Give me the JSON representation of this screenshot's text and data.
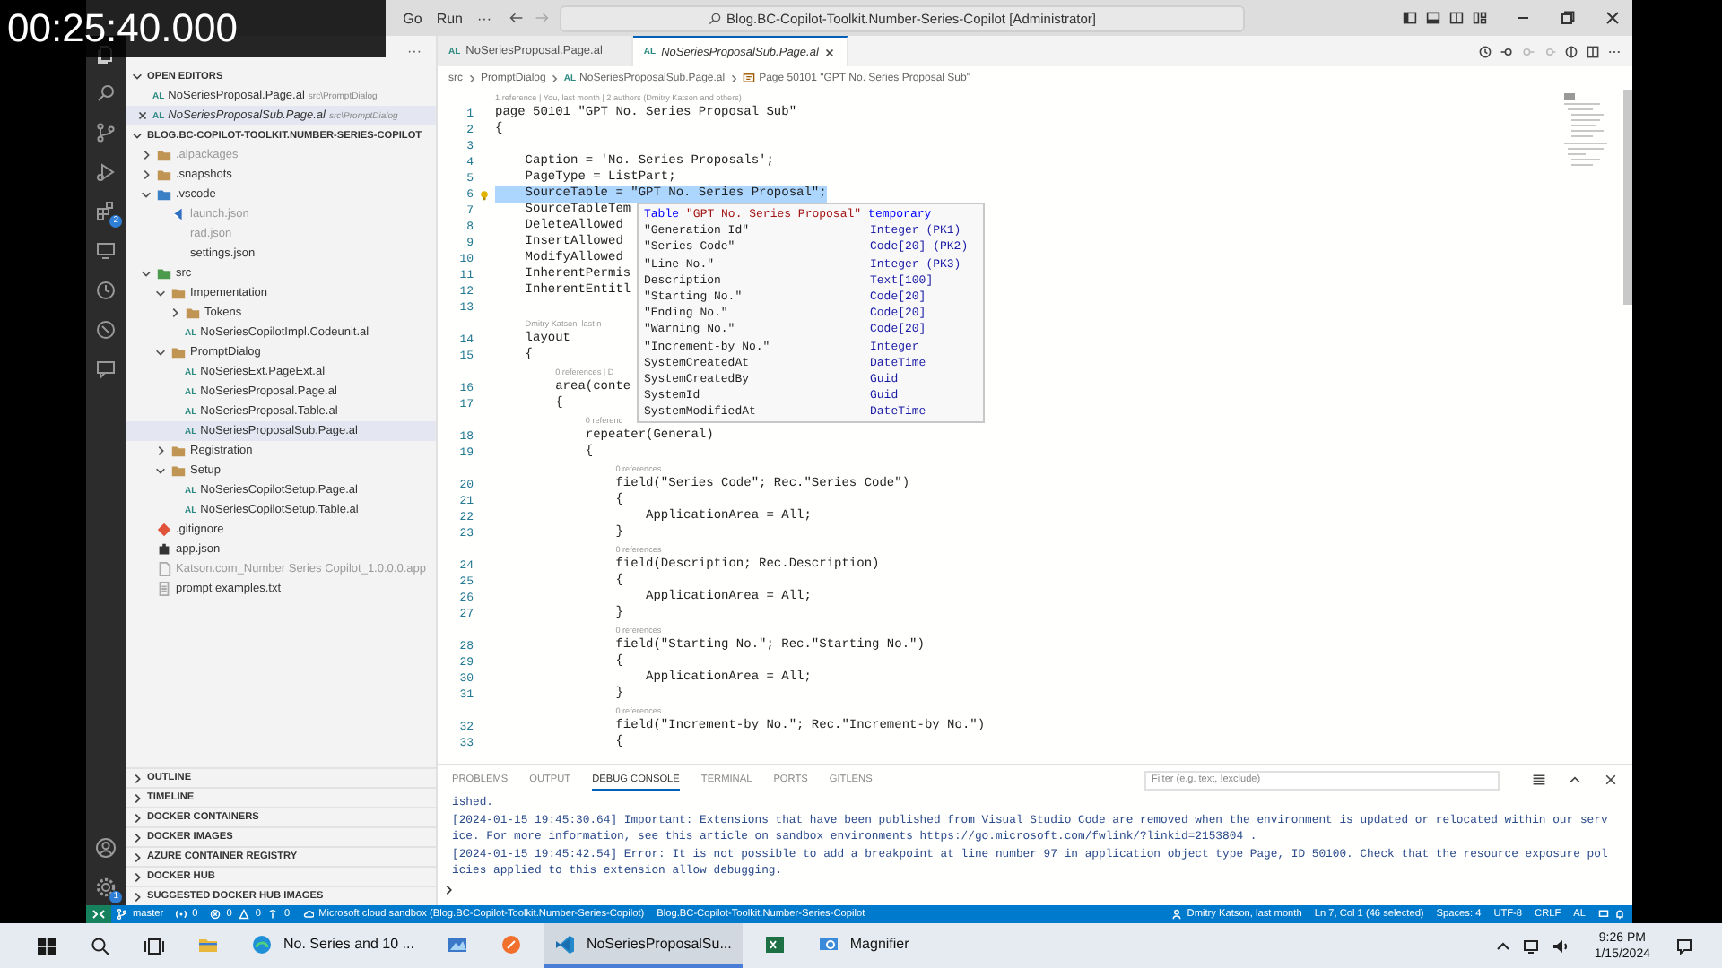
{
  "timestamp": "00:25:40.000",
  "menu": [
    "Go",
    "Run",
    "···"
  ],
  "command_center": "Blog.BC-Copilot-Toolkit.Number-Series-Copilot [Administrator]",
  "activity_bar": {
    "extensions_badge": "2",
    "settings_badge": "1"
  },
  "sidebar": {
    "more": "···",
    "open_editors": {
      "title": "OPEN EDITORS",
      "expanded": true,
      "items": [
        {
          "name": "NoSeriesProposal.Page.al",
          "label": "AL",
          "path": "src\\PromptDialog",
          "selected": false
        },
        {
          "name": "NoSeriesProposalSub.Page.al",
          "label": "AL",
          "path": "src\\PromptDialog",
          "selected": true
        }
      ]
    },
    "workspace": {
      "title": "BLOG.BC-COPILOT-TOOLKIT.NUMBER-SERIES-COPILOT",
      "expanded": true,
      "tree": [
        {
          "name": ".alpackages",
          "kind": "folder",
          "expanded": false,
          "selected": false,
          "dimmed": true
        },
        {
          "name": ".snapshots",
          "kind": "folder",
          "expanded": false,
          "selected": false,
          "dimmed": false
        },
        {
          "name": ".vscode",
          "kind": "vscode-folder",
          "expanded": true,
          "selected": false,
          "dimmed": false,
          "children": [
            {
              "name": "launch.json",
              "kind": "launch",
              "selected": false,
              "dimmed": true
            },
            {
              "name": "rad.json",
              "kind": "plain",
              "selected": false,
              "dimmed": true
            },
            {
              "name": "settings.json",
              "kind": "plain",
              "selected": false,
              "dimmed": false
            }
          ]
        },
        {
          "name": "src",
          "kind": "src-folder",
          "expanded": true,
          "selected": false,
          "dimmed": false,
          "children": [
            {
              "name": "Impementation",
              "kind": "folder",
              "expanded": true,
              "selected": false,
              "dimmed": false,
              "children": [
                {
                  "name": "Tokens",
                  "kind": "folder",
                  "expanded": false,
                  "selected": false,
                  "dimmed": false
                },
                {
                  "name": "NoSeriesCopilotImpl.Codeunit.al",
                  "kind": "al",
                  "label": "AL",
                  "selected": false,
                  "dimmed": false
                }
              ]
            },
            {
              "name": "PromptDialog",
              "kind": "folder",
              "expanded": true,
              "selected": false,
              "dimmed": false,
              "children": [
                {
                  "name": "NoSeriesExt.PageExt.al",
                  "kind": "al",
                  "label": "AL",
                  "selected": false,
                  "dimmed": false
                },
                {
                  "name": "NoSeriesProposal.Page.al",
                  "kind": "al",
                  "label": "AL",
                  "selected": false,
                  "dimmed": false
                },
                {
                  "name": "NoSeriesProposal.Table.al",
                  "kind": "al",
                  "label": "AL",
                  "selected": false,
                  "dimmed": false
                },
                {
                  "name": "NoSeriesProposalSub.Page.al",
                  "kind": "al",
                  "label": "AL",
                  "selected": true,
                  "dimmed": false
                }
              ]
            },
            {
              "name": "Registration",
              "kind": "folder",
              "expanded": false,
              "selected": false,
              "dimmed": false
            },
            {
              "name": "Setup",
              "kind": "folder",
              "expanded": true,
              "selected": false,
              "dimmed": false,
              "children": [
                {
                  "name": "NoSeriesCopilotSetup.Page.al",
                  "kind": "al",
                  "label": "AL",
                  "selected": false,
                  "dimmed": false
                },
                {
                  "name": "NoSeriesCopilotSetup.Table.al",
                  "kind": "al",
                  "label": "AL",
                  "selected": false,
                  "dimmed": false
                }
              ]
            }
          ]
        },
        {
          "name": ".gitignore",
          "kind": "git",
          "selected": false,
          "dimmed": false
        },
        {
          "name": "app.json",
          "kind": "manifest",
          "selected": false,
          "dimmed": false
        },
        {
          "name": "Katson.com_Number Series Copilot_1.0.0.0.app",
          "kind": "package",
          "selected": false,
          "dimmed": true
        },
        {
          "name": "prompt examples.txt",
          "kind": "text",
          "selected": false,
          "dimmed": false
        }
      ]
    },
    "sections": [
      {
        "title": "OUTLINE",
        "expanded": false
      },
      {
        "title": "TIMELINE",
        "expanded": false
      },
      {
        "title": "DOCKER CONTAINERS",
        "expanded": false
      },
      {
        "title": "DOCKER IMAGES",
        "expanded": false
      },
      {
        "title": "AZURE CONTAINER REGISTRY",
        "expanded": false
      },
      {
        "title": "DOCKER HUB",
        "expanded": false
      },
      {
        "title": "SUGGESTED DOCKER HUB IMAGES",
        "expanded": false
      }
    ]
  },
  "tabs": [
    {
      "label": "NoSeriesProposal.Page.al",
      "icon": "AL",
      "selected": false
    },
    {
      "label": "NoSeriesProposalSub.Page.al",
      "icon": "AL",
      "selected": true
    }
  ],
  "breadcrumb": [
    {
      "text": "src",
      "kind": "folder"
    },
    {
      "text": "PromptDialog",
      "kind": "folder"
    },
    {
      "text": "NoSeriesProposalSub.Page.al",
      "kind": "file",
      "icon": "AL"
    },
    {
      "text": "Page 50101 \"GPT No. Series Proposal Sub\"",
      "kind": "symbol"
    }
  ],
  "editor": {
    "lines": [
      {
        "kind": "lens",
        "text": "1 reference | You, last month | 2 authors (Dmitry Katson and others)"
      },
      {
        "kind": "code",
        "number": "1",
        "text": "page 50101 \"GPT No. Series Proposal Sub\"",
        "selected": false
      },
      {
        "kind": "code",
        "number": "2",
        "text": "{",
        "selected": false
      },
      {
        "kind": "code",
        "number": "3",
        "selected": false
      },
      {
        "kind": "code",
        "number": "4",
        "text": "    Caption = 'No. Series Proposals';",
        "selected": false
      },
      {
        "kind": "code",
        "number": "5",
        "text": "    PageType = ListPart;",
        "selected": false
      },
      {
        "kind": "code",
        "number": "6",
        "text": "    SourceTable = \"GPT No. Series Proposal\";",
        "selected": true
      },
      {
        "kind": "code",
        "number": "7",
        "text": "    SourceTableTem",
        "selected": false
      },
      {
        "kind": "code",
        "number": "8",
        "text": "    DeleteAllowed",
        "selected": false
      },
      {
        "kind": "code",
        "number": "9",
        "text": "    InsertAllowed",
        "selected": false
      },
      {
        "kind": "code",
        "number": "10",
        "text": "    ModifyAllowed",
        "selected": false
      },
      {
        "kind": "code",
        "number": "11",
        "text": "    InherentPermis",
        "selected": false
      },
      {
        "kind": "code",
        "number": "12",
        "text": "    InherentEntitl",
        "selected": false
      },
      {
        "kind": "code",
        "number": "13",
        "selected": false
      },
      {
        "kind": "lens",
        "text": "Dmitry Katson, last n"
      },
      {
        "kind": "code",
        "number": "14",
        "text": "    layout",
        "selected": false
      },
      {
        "kind": "code",
        "number": "15",
        "text": "    {",
        "selected": false
      },
      {
        "kind": "lens",
        "text": "0 references | D"
      },
      {
        "kind": "code",
        "number": "16",
        "text": "        area(conte",
        "selected": false
      },
      {
        "kind": "code",
        "number": "17",
        "text": "        {",
        "selected": false
      },
      {
        "kind": "lens",
        "text": "0 referenc"
      },
      {
        "kind": "code",
        "number": "18",
        "text": "            repeater(General)",
        "selected": false
      },
      {
        "kind": "code",
        "number": "19",
        "text": "            {",
        "selected": false
      },
      {
        "kind": "lens",
        "text": "0 references"
      },
      {
        "kind": "code",
        "number": "20",
        "text": "                field(\"Series Code\"; Rec.\"Series Code\")",
        "selected": false
      },
      {
        "kind": "code",
        "number": "21",
        "text": "                {",
        "selected": false
      },
      {
        "kind": "code",
        "number": "22",
        "text": "                    ApplicationArea = All;",
        "selected": false
      },
      {
        "kind": "code",
        "number": "23",
        "text": "                }",
        "selected": false
      },
      {
        "kind": "lens",
        "text": "0 references"
      },
      {
        "kind": "code",
        "number": "24",
        "text": "                field(Description; Rec.Description)",
        "selected": false
      },
      {
        "kind": "code",
        "number": "25",
        "text": "                {",
        "selected": false
      },
      {
        "kind": "code",
        "number": "26",
        "text": "                    ApplicationArea = All;",
        "selected": false
      },
      {
        "kind": "code",
        "number": "27",
        "text": "                }",
        "selected": false
      },
      {
        "kind": "lens",
        "text": "0 references"
      },
      {
        "kind": "code",
        "number": "28",
        "text": "                field(\"Starting No.\"; Rec.\"Starting No.\")",
        "selected": false
      },
      {
        "kind": "code",
        "number": "29",
        "text": "                {",
        "selected": false
      },
      {
        "kind": "code",
        "number": "30",
        "text": "                    ApplicationArea = All;",
        "selected": false
      },
      {
        "kind": "code",
        "number": "31",
        "text": "                }",
        "selected": false
      },
      {
        "kind": "lens",
        "text": "0 references"
      },
      {
        "kind": "code",
        "number": "32",
        "text": "                field(\"Increment-by No.\"; Rec.\"Increment-by No.\")",
        "selected": false
      },
      {
        "kind": "code",
        "number": "33",
        "text": "                {",
        "selected": false
      }
    ],
    "hover": {
      "keyword": "Table",
      "name": "\"GPT No. Series Proposal\"",
      "modifier": "temporary",
      "fields": [
        {
          "name": "\"Generation Id\"",
          "type": "Integer (PK1)"
        },
        {
          "name": "\"Series Code\"",
          "type": "Code[20] (PK2)"
        },
        {
          "name": "\"Line No.\"",
          "type": "Integer (PK3)"
        },
        {
          "name": "Description",
          "type": "Text[100]"
        },
        {
          "name": "\"Starting No.\"",
          "type": "Code[20]"
        },
        {
          "name": "\"Ending No.\"",
          "type": "Code[20]"
        },
        {
          "name": "\"Warning No.\"",
          "type": "Code[20]"
        },
        {
          "name": "\"Increment-by No.\"",
          "type": "Integer"
        },
        {
          "name": "SystemCreatedAt",
          "type": "DateTime"
        },
        {
          "name": "SystemCreatedBy",
          "type": "Guid"
        },
        {
          "name": "SystemId",
          "type": "Guid"
        },
        {
          "name": "SystemModifiedAt",
          "type": "DateTime"
        }
      ]
    }
  },
  "panel": {
    "tabs": [
      {
        "label": "PROBLEMS",
        "selected": false
      },
      {
        "label": "OUTPUT",
        "selected": false
      },
      {
        "label": "DEBUG CONSOLE",
        "selected": true
      },
      {
        "label": "TERMINAL",
        "selected": false
      },
      {
        "label": "PORTS",
        "selected": false
      },
      {
        "label": "GITLENS",
        "selected": false
      }
    ],
    "filter": {
      "placeholder": "Filter (e.g. text, !exclude)"
    },
    "console": [
      "ished.",
      "[2024-01-15 19:45:30.64] Important: Extensions that have been published from Visual Studio Code are removed when the environment is updated or relocated within our serv",
      "ice. For more information, see this article on sandbox environments https://go.microsoft.com/fwlink/?linkid=2153804 .",
      "[2024-01-15 19:45:42.54] Error: It is not possible to add a breakpoint at line number 97 in application object type Page, ID 50100. Check that the resource exposure pol",
      "icies applied to this extension allow debugging."
    ]
  },
  "status_bar": {
    "left": [
      {
        "kind": "branch",
        "text": "master"
      },
      {
        "kind": "ports",
        "text": "0"
      },
      {
        "kind": "errors",
        "text": "0"
      },
      {
        "kind": "warnings",
        "text": "0"
      },
      {
        "kind": "info",
        "text": "0"
      },
      {
        "kind": "cloud",
        "text": "Microsoft cloud sandbox (Blog.BC-Copilot-Toolkit.Number-Series-Copilot)"
      },
      {
        "kind": "plain",
        "text": "Blog.BC-Copilot-Toolkit.Number-Series-Copilot"
      }
    ],
    "right": [
      {
        "kind": "blame",
        "text": "Dmitry Katson, last month"
      },
      {
        "kind": "plain",
        "text": "Ln 7, Col 1 (46 selected)"
      },
      {
        "kind": "plain",
        "text": "Spaces: 4"
      },
      {
        "kind": "plain",
        "text": "UTF-8"
      },
      {
        "kind": "plain",
        "text": "CRLF"
      },
      {
        "kind": "plain",
        "text": "AL"
      }
    ]
  },
  "taskbar": {
    "apps": [
      {
        "kind": "explorer",
        "selected": false
      },
      {
        "kind": "edge",
        "label": "No. Series and 10 ...",
        "selected": false
      },
      {
        "kind": "paint",
        "selected": false
      },
      {
        "kind": "orange",
        "selected": false
      },
      {
        "kind": "vscode",
        "label": "NoSeriesProposalSu...",
        "selected": true
      },
      {
        "kind": "excel",
        "selected": false
      },
      {
        "kind": "magnifier",
        "label": "Magnifier",
        "selected": false
      }
    ],
    "time": "9:26 PM",
    "date": "1/15/2024"
  }
}
